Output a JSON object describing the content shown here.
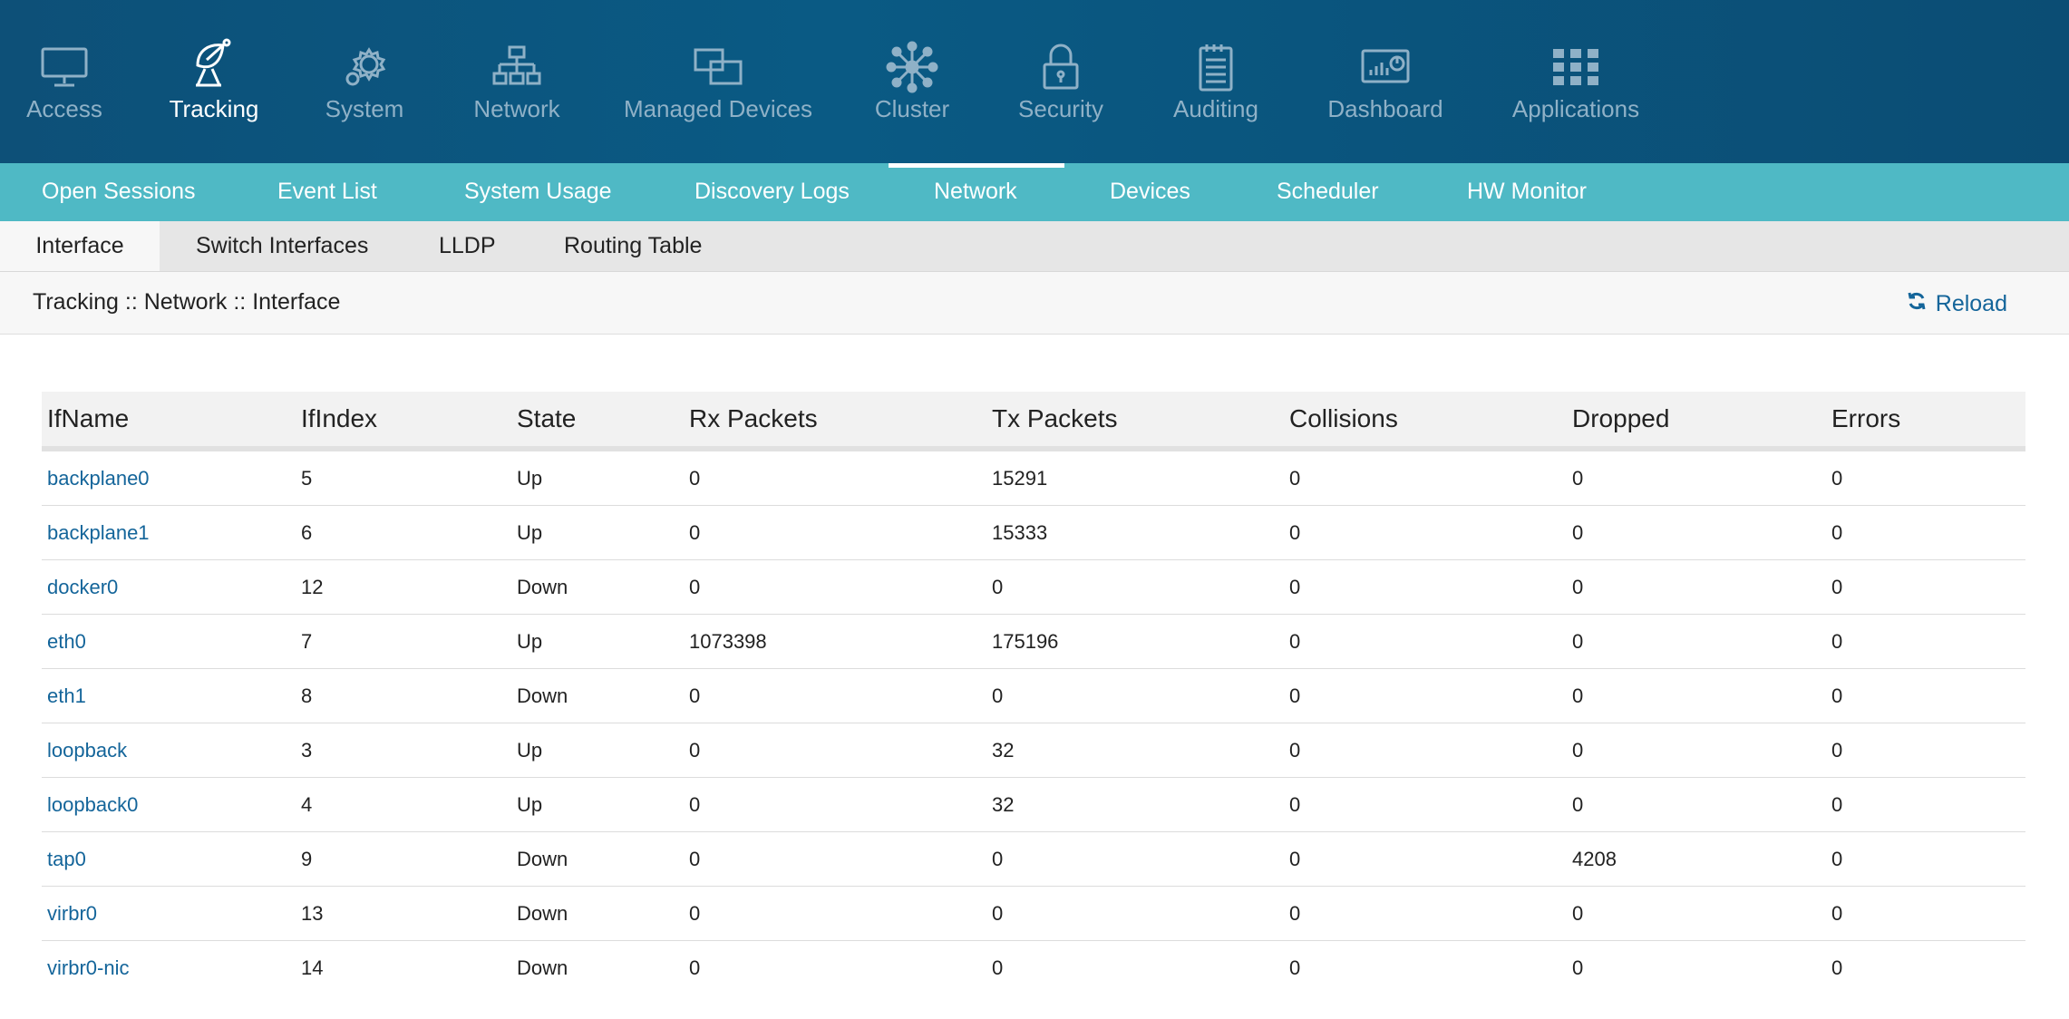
{
  "topnav": {
    "items": [
      {
        "label": "Access",
        "icon": "monitor-icon",
        "active": false
      },
      {
        "label": "Tracking",
        "icon": "satellite-dish-icon",
        "active": true
      },
      {
        "label": "System",
        "icon": "gear-icon",
        "active": false
      },
      {
        "label": "Network",
        "icon": "network-tree-icon",
        "active": false
      },
      {
        "label": "Managed Devices",
        "icon": "devices-icon",
        "active": false
      },
      {
        "label": "Cluster",
        "icon": "cluster-icon",
        "active": false
      },
      {
        "label": "Security",
        "icon": "lock-icon",
        "active": false
      },
      {
        "label": "Auditing",
        "icon": "notepad-icon",
        "active": false
      },
      {
        "label": "Dashboard",
        "icon": "dashboard-icon",
        "active": false
      },
      {
        "label": "Applications",
        "icon": "grid-icon",
        "active": false
      }
    ]
  },
  "subnav": {
    "items": [
      "Open Sessions",
      "Event List",
      "System Usage",
      "Discovery Logs",
      "Network",
      "Devices",
      "Scheduler",
      "HW Monitor"
    ],
    "active": "Network"
  },
  "tabs": {
    "items": [
      "Interface",
      "Switch Interfaces",
      "LLDP",
      "Routing Table"
    ],
    "active": "Interface"
  },
  "breadcrumb": "Tracking :: Network :: Interface",
  "reload_label": "Reload",
  "table": {
    "headers": [
      "IfName",
      "IfIndex",
      "State",
      "Rx Packets",
      "Tx Packets",
      "Collisions",
      "Dropped",
      "Errors"
    ],
    "rows": [
      [
        "backplane0",
        "5",
        "Up",
        "0",
        "15291",
        "0",
        "0",
        "0"
      ],
      [
        "backplane1",
        "6",
        "Up",
        "0",
        "15333",
        "0",
        "0",
        "0"
      ],
      [
        "docker0",
        "12",
        "Down",
        "0",
        "0",
        "0",
        "0",
        "0"
      ],
      [
        "eth0",
        "7",
        "Up",
        "1073398",
        "175196",
        "0",
        "0",
        "0"
      ],
      [
        "eth1",
        "8",
        "Down",
        "0",
        "0",
        "0",
        "0",
        "0"
      ],
      [
        "loopback",
        "3",
        "Up",
        "0",
        "32",
        "0",
        "0",
        "0"
      ],
      [
        "loopback0",
        "4",
        "Up",
        "0",
        "32",
        "0",
        "0",
        "0"
      ],
      [
        "tap0",
        "9",
        "Down",
        "0",
        "0",
        "0",
        "4208",
        "0"
      ],
      [
        "virbr0",
        "13",
        "Down",
        "0",
        "0",
        "0",
        "0",
        "0"
      ],
      [
        "virbr0-nic",
        "14",
        "Down",
        "0",
        "0",
        "0",
        "0",
        "0"
      ]
    ]
  },
  "colors": {
    "topnav_bg": "#0a5a84",
    "subnav_bg": "#4fb9c5",
    "link": "#14659a"
  }
}
